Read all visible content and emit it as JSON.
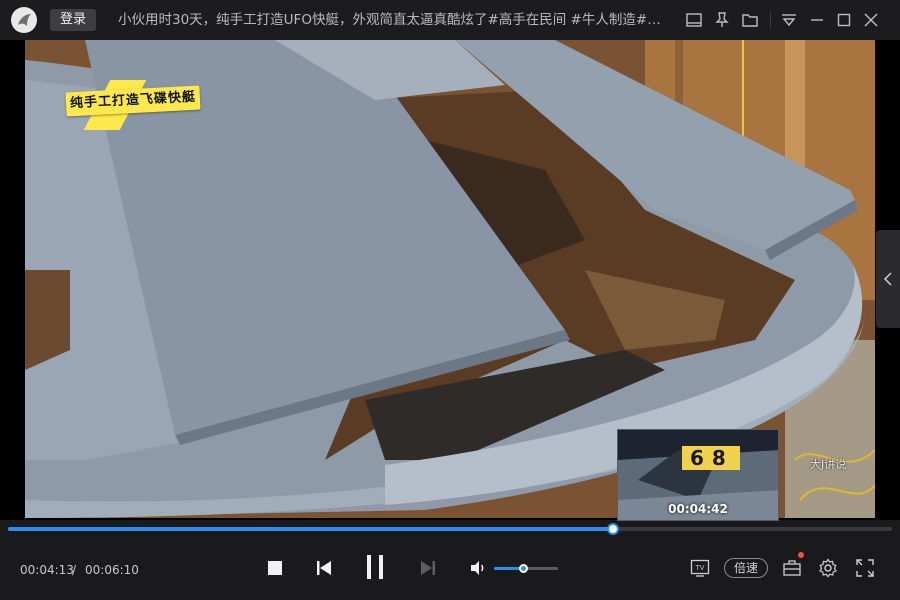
{
  "header": {
    "login_label": "登录",
    "video_title": "小伙用时30天，纯手工打造UFO快艇，外观简直太逼真酷炫了#高手在民间 #牛人制造#手工..."
  },
  "titlebar_icons": [
    "mini-window-icon",
    "pin-icon",
    "folder-icon",
    "menu-icon",
    "minimize-icon",
    "maximize-icon",
    "close-icon"
  ],
  "video": {
    "caption_sticker": "纯手工打造飞碟快艇",
    "preview_time": "00:04:42",
    "watermark": "大J讲说",
    "preview_sign_digits": "68"
  },
  "player": {
    "current_time": "00:04:13",
    "separator": "/",
    "total_time": "00:06:10",
    "progress": 0.684,
    "volume": 0.45,
    "speed_label": "倍速"
  },
  "colors": {
    "accent": "#2e8cf0",
    "notification": "#ff4b3e",
    "sticker": "#ffe94a"
  }
}
